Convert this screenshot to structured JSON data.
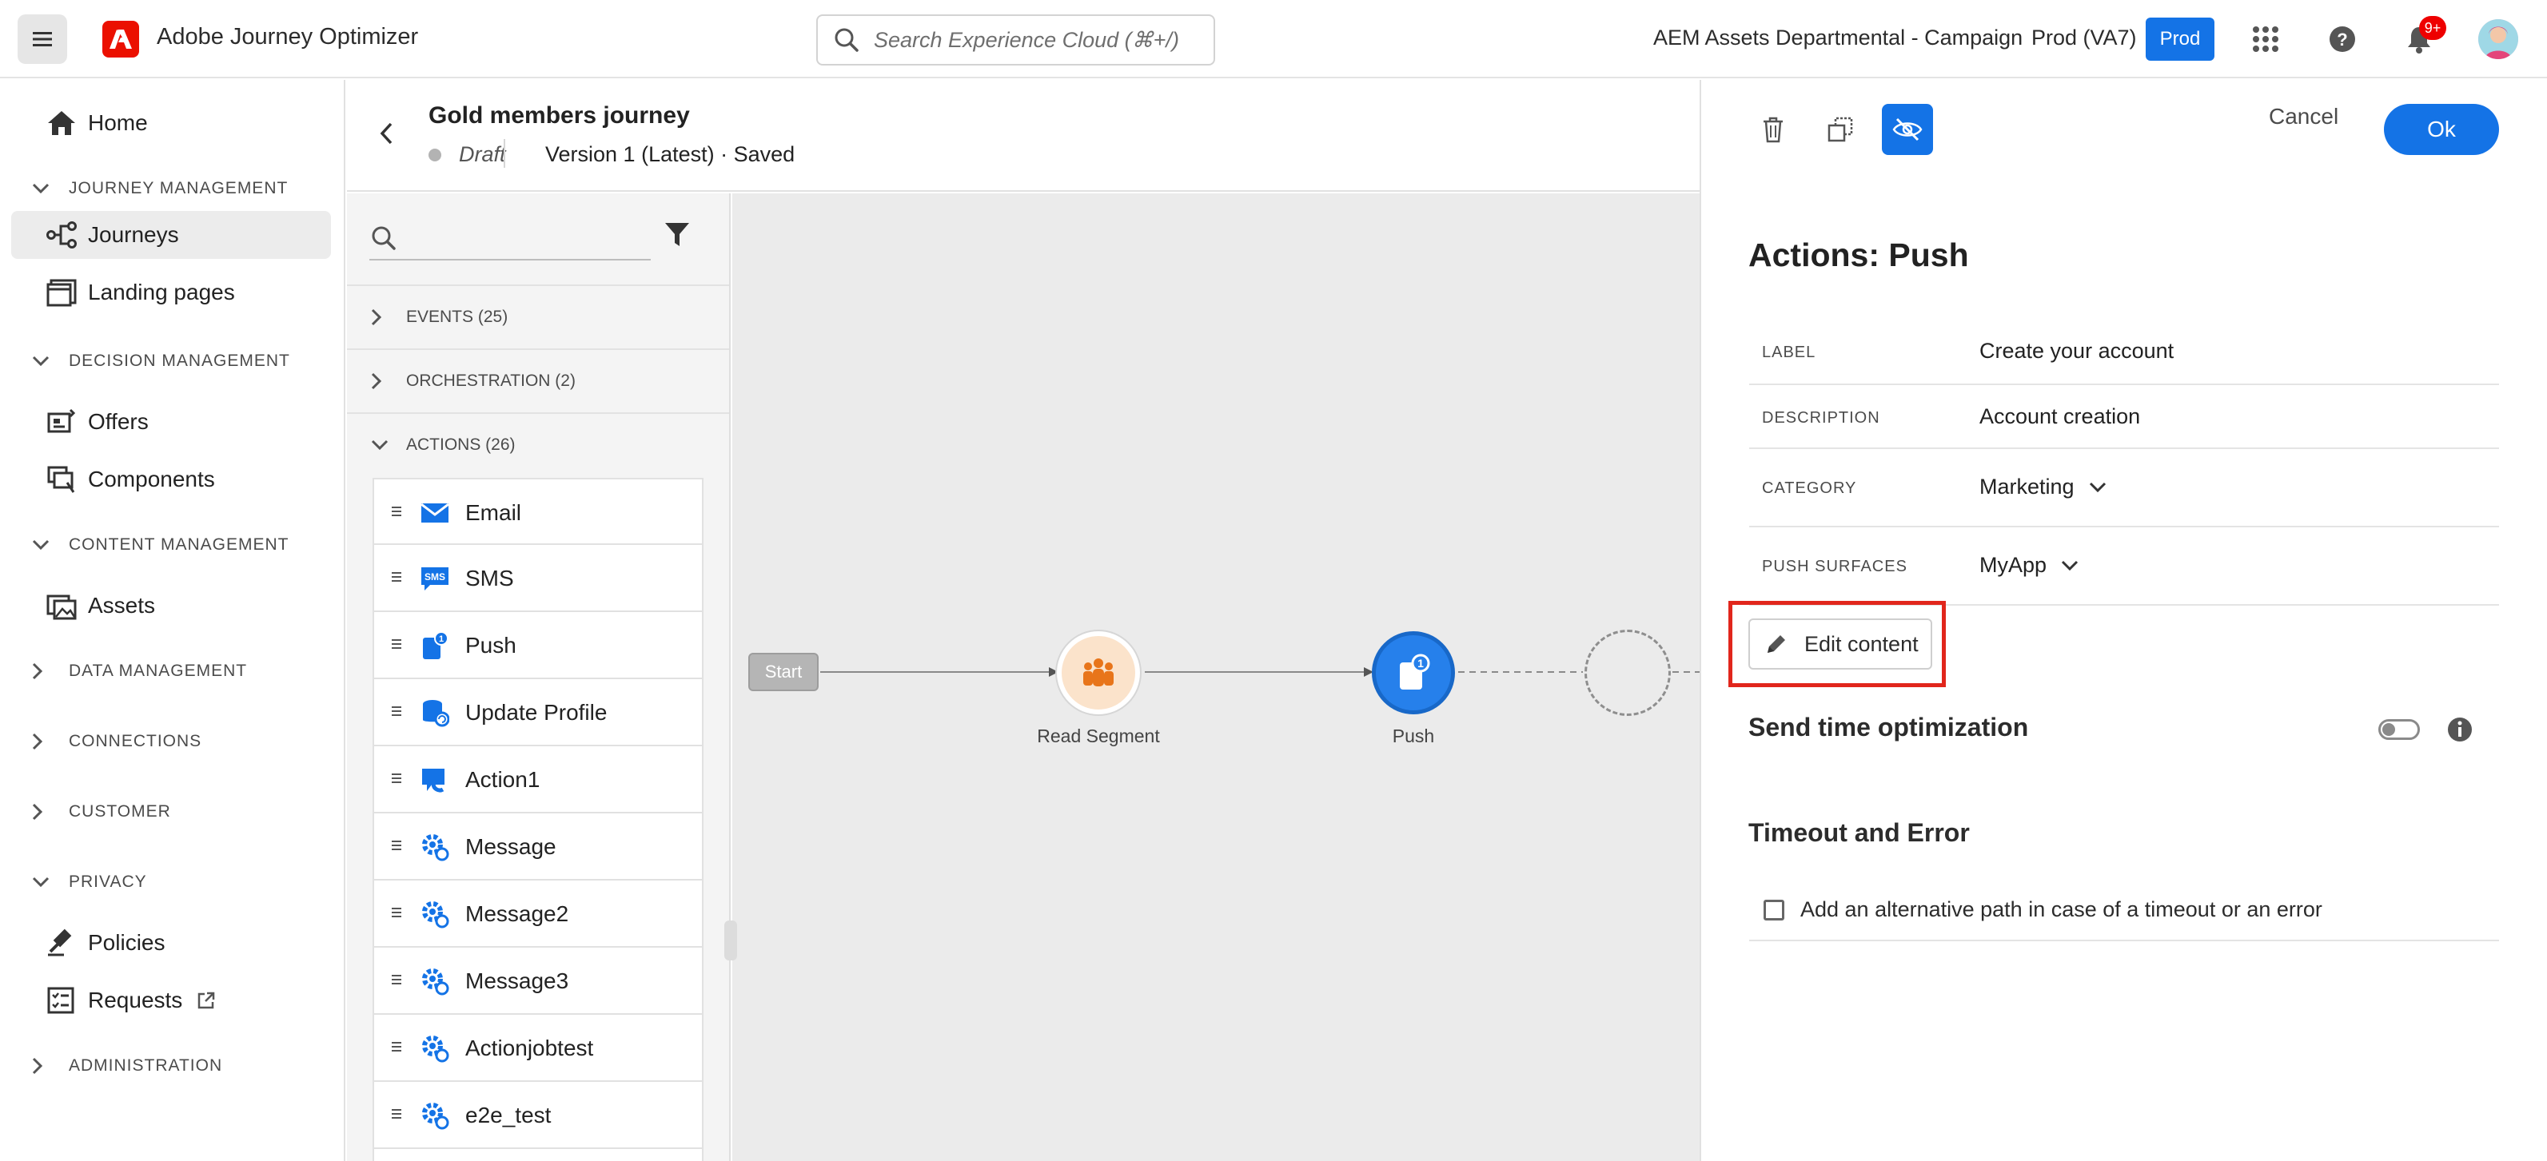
{
  "app": {
    "title": "Adobe Journey Optimizer"
  },
  "search": {
    "placeholder": "Search Experience Cloud (⌘+/)"
  },
  "header": {
    "org": "AEM Assets Departmental - Campaign",
    "sandbox": "Prod (VA7)",
    "sandbox_badge": "Prod",
    "notifications_count": "9+"
  },
  "nav": {
    "home": "Home",
    "sections": [
      {
        "label": "JOURNEY MANAGEMENT",
        "items": [
          "Journeys",
          "Landing pages"
        ]
      },
      {
        "label": "DECISION MANAGEMENT",
        "items": [
          "Offers",
          "Components"
        ]
      },
      {
        "label": "CONTENT MANAGEMENT",
        "items": [
          "Assets"
        ]
      },
      {
        "label": "DATA MANAGEMENT",
        "items": []
      },
      {
        "label": "CONNECTIONS",
        "items": []
      },
      {
        "label": "CUSTOMER",
        "items": []
      },
      {
        "label": "PRIVACY",
        "items": [
          "Policies",
          "Requests"
        ]
      },
      {
        "label": "ADMINISTRATION",
        "items": []
      }
    ],
    "active": "Journeys"
  },
  "journey": {
    "title": "Gold members journey",
    "status": "Draft",
    "version": "Version 1 (Latest) · Saved"
  },
  "palette": {
    "categories": [
      "EVENTS (25)",
      "ORCHESTRATION (2)",
      "ACTIONS (26)"
    ],
    "actions": [
      {
        "label": "Email",
        "icon": "email-icon"
      },
      {
        "label": "SMS",
        "icon": "sms-icon"
      },
      {
        "label": "Push",
        "icon": "push-icon"
      },
      {
        "label": "Update Profile",
        "icon": "update-profile-icon"
      },
      {
        "label": "Action1",
        "icon": "custom-action-icon"
      },
      {
        "label": "Message",
        "icon": "gear-icon"
      },
      {
        "label": "Message2",
        "icon": "gear-icon"
      },
      {
        "label": "Message3",
        "icon": "gear-icon"
      },
      {
        "label": "Actionjobtest",
        "icon": "gear-icon"
      },
      {
        "label": "e2e_test",
        "icon": "gear-icon"
      }
    ]
  },
  "canvas": {
    "start_label": "Start",
    "nodes": [
      {
        "label": "Read Segment",
        "icon": "people-icon"
      },
      {
        "label": "Push",
        "icon": "push-icon",
        "badge": "1"
      }
    ]
  },
  "panel": {
    "title": "Actions: Push",
    "cancel_label": "Cancel",
    "ok_label": "Ok",
    "fields": [
      {
        "key": "LABEL",
        "value": "Create your account"
      },
      {
        "key": "DESCRIPTION",
        "value": "Account creation"
      },
      {
        "key": "CATEGORY",
        "value": "Marketing"
      },
      {
        "key": "PUSH SURFACES",
        "value": "MyApp"
      }
    ],
    "edit_content_label": "Edit content",
    "send_time_title": "Send time optimization",
    "send_time_enabled": false,
    "timeout_title": "Timeout and Error",
    "timeout_checkbox_label": "Add an alternative path in case of a timeout or an error",
    "timeout_checked": false
  },
  "colors": {
    "accent": "#1473e6",
    "brand": "#eb1000",
    "highlight": "#e1261c",
    "segment_node": "#fbe3cb",
    "push_node": "#2680eb"
  }
}
